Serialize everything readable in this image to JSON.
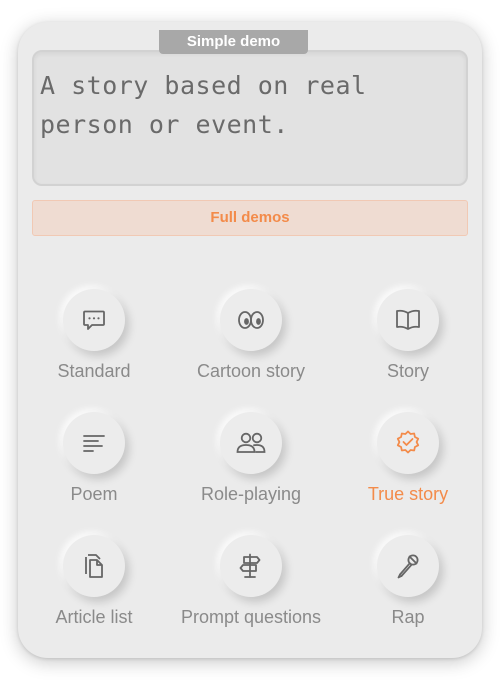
{
  "preview": {
    "badge": "Simple demo",
    "text": "A story based on real person or event."
  },
  "full_demos_label": "Full demos",
  "accent_color": "#f38b4a",
  "items": [
    {
      "label": "Standard",
      "icon": "chat-bubble-icon"
    },
    {
      "label": "Cartoon story",
      "icon": "cartoon-eyes-icon"
    },
    {
      "label": "Story",
      "icon": "open-book-icon"
    },
    {
      "label": "Poem",
      "icon": "text-lines-icon"
    },
    {
      "label": "Role-playing",
      "icon": "people-icon"
    },
    {
      "label": "True story",
      "icon": "verified-badge-icon",
      "selected": true
    },
    {
      "label": "Article list",
      "icon": "documents-icon"
    },
    {
      "label": "Prompt questions",
      "icon": "signpost-icon"
    },
    {
      "label": "Rap",
      "icon": "microphone-icon"
    }
  ]
}
